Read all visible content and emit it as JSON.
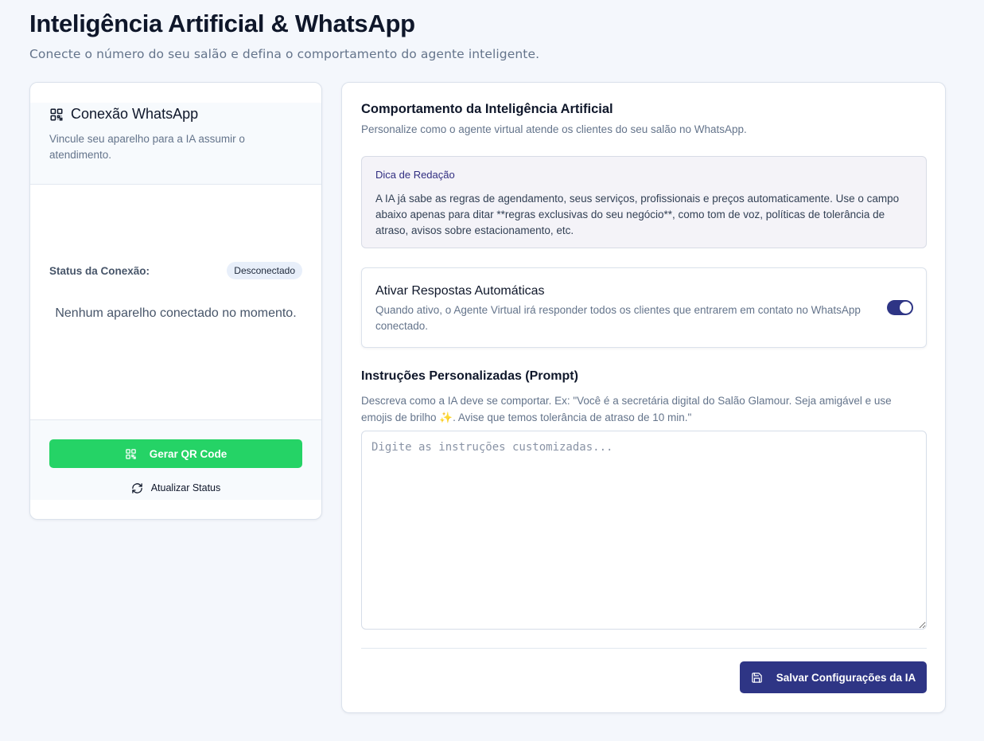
{
  "header": {
    "title": "Inteligência Artificial & WhatsApp",
    "subtitle": "Conecte o número do seu salão e defina o comportamento do agente inteligente."
  },
  "whatsapp_card": {
    "icon": "qr-code-icon",
    "title": "Conexão WhatsApp",
    "description": "Vincule seu aparelho para a IA assumir o atendimento.",
    "status_label": "Status da Conexão:",
    "status_badge": "Desconectado",
    "empty_message": "Nenhum aparelho conectado no momento.",
    "generate_qr_label": "Gerar QR Code",
    "refresh_label": "Atualizar Status",
    "colors": {
      "whatsapp_green": "#25d366"
    }
  },
  "ai_card": {
    "title": "Comportamento da Inteligência Artificial",
    "description": "Personalize como o agente virtual atende os clientes do seu salão no WhatsApp.",
    "tip": {
      "title": "Dica de Redação",
      "text": "A IA já sabe as regras de agendamento, seus serviços, profissionais e preços automaticamente. Use o campo abaixo apenas para ditar **regras exclusivas do seu negócio**, como tom de voz, políticas de tolerância de atraso, avisos sobre estacionamento, etc."
    },
    "auto_reply": {
      "title": "Ativar Respostas Automáticas",
      "description": "Quando ativo, o Agente Virtual irá responder todos os clientes que entrarem em contato no WhatsApp conectado.",
      "enabled": true
    },
    "prompt": {
      "title": "Instruções Personalizadas (Prompt)",
      "description": "Descreva como a IA deve se comportar. Ex: \"Você é a secretária digital do Salão Glamour. Seja amigável e use emojis de brilho ✨. Avise que temos tolerância de atraso de 10 min.\"",
      "placeholder": "Digite as instruções customizadas...",
      "value": ""
    },
    "save_label": "Salvar Configurações da IA",
    "colors": {
      "primary": "#2e3585"
    }
  }
}
